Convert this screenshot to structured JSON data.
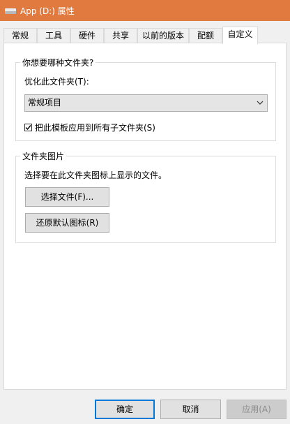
{
  "window": {
    "title": "App (D:) 属性",
    "accent": "#e07a3f"
  },
  "tabs": [
    {
      "label": "常规"
    },
    {
      "label": "工具"
    },
    {
      "label": "硬件"
    },
    {
      "label": "共享"
    },
    {
      "label": "以前的版本"
    },
    {
      "label": "配额"
    },
    {
      "label": "自定义"
    }
  ],
  "active_tab": "自定义",
  "folder_type_group": {
    "title": "你想要哪种文件夹?",
    "optimize_label": "优化此文件夹(T):",
    "optimize_value": "常规项目",
    "apply_subfolders_label": "把此模板应用到所有子文件夹(S)",
    "apply_subfolders_checked": true
  },
  "folder_picture_group": {
    "title": "文件夹图片",
    "description": "选择要在此文件夹图标上显示的文件。",
    "choose_file_button": "选择文件(F)...",
    "restore_default_button": "还原默认图标(R)"
  },
  "footer": {
    "ok": "确定",
    "cancel": "取消",
    "apply": "应用(A)"
  }
}
